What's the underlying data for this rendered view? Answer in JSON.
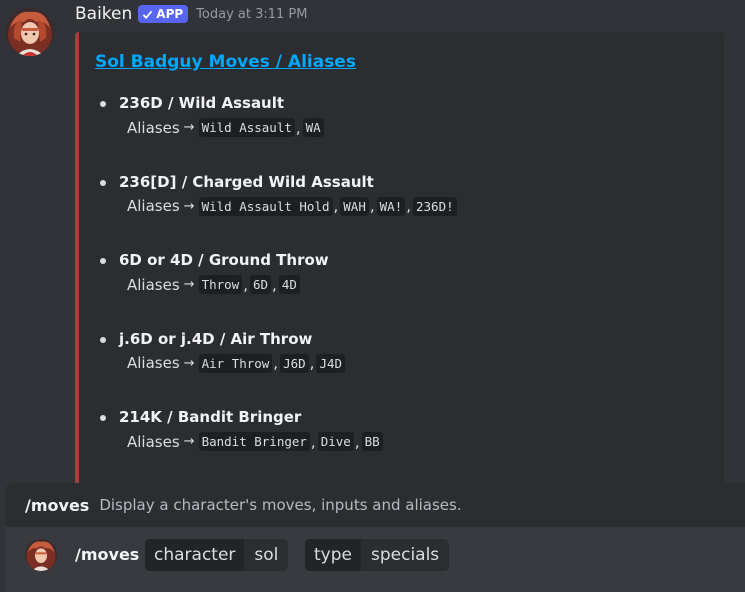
{
  "message": {
    "username": "Baiken",
    "badge": "APP",
    "timestamp": "Today at 3:11 PM"
  },
  "embed": {
    "title": "Sol Badguy Moves / Aliases",
    "accent_color": "#a0413a",
    "alias_label": "Aliases",
    "moves": [
      {
        "name": "236D / Wild Assault",
        "aliases": [
          "Wild Assault",
          "WA"
        ]
      },
      {
        "name": "236[D] / Charged Wild Assault",
        "aliases": [
          "Wild Assault Hold",
          "WAH",
          "WA!",
          "236D!"
        ]
      },
      {
        "name": "6D or 4D / Ground Throw",
        "aliases": [
          "Throw",
          "6D",
          "4D"
        ]
      },
      {
        "name": "j.6D or j.4D / Air Throw",
        "aliases": [
          "Air Throw",
          "J6D",
          "J4D"
        ]
      },
      {
        "name": "214K / Bandit Bringer",
        "aliases": [
          "Bandit Bringer",
          "Dive",
          "BB"
        ]
      }
    ]
  },
  "command_hint": {
    "name": "/moves",
    "description": "Display a character's moves, inputs and aliases."
  },
  "input": {
    "command": "/moves",
    "options": [
      {
        "key": "character",
        "value": "sol"
      },
      {
        "key": "type",
        "value": "specials"
      }
    ]
  },
  "icons": {
    "avatar": "baiken-avatar",
    "badge_check": "checkmark-icon",
    "arrow": "arrow-right-icon"
  }
}
